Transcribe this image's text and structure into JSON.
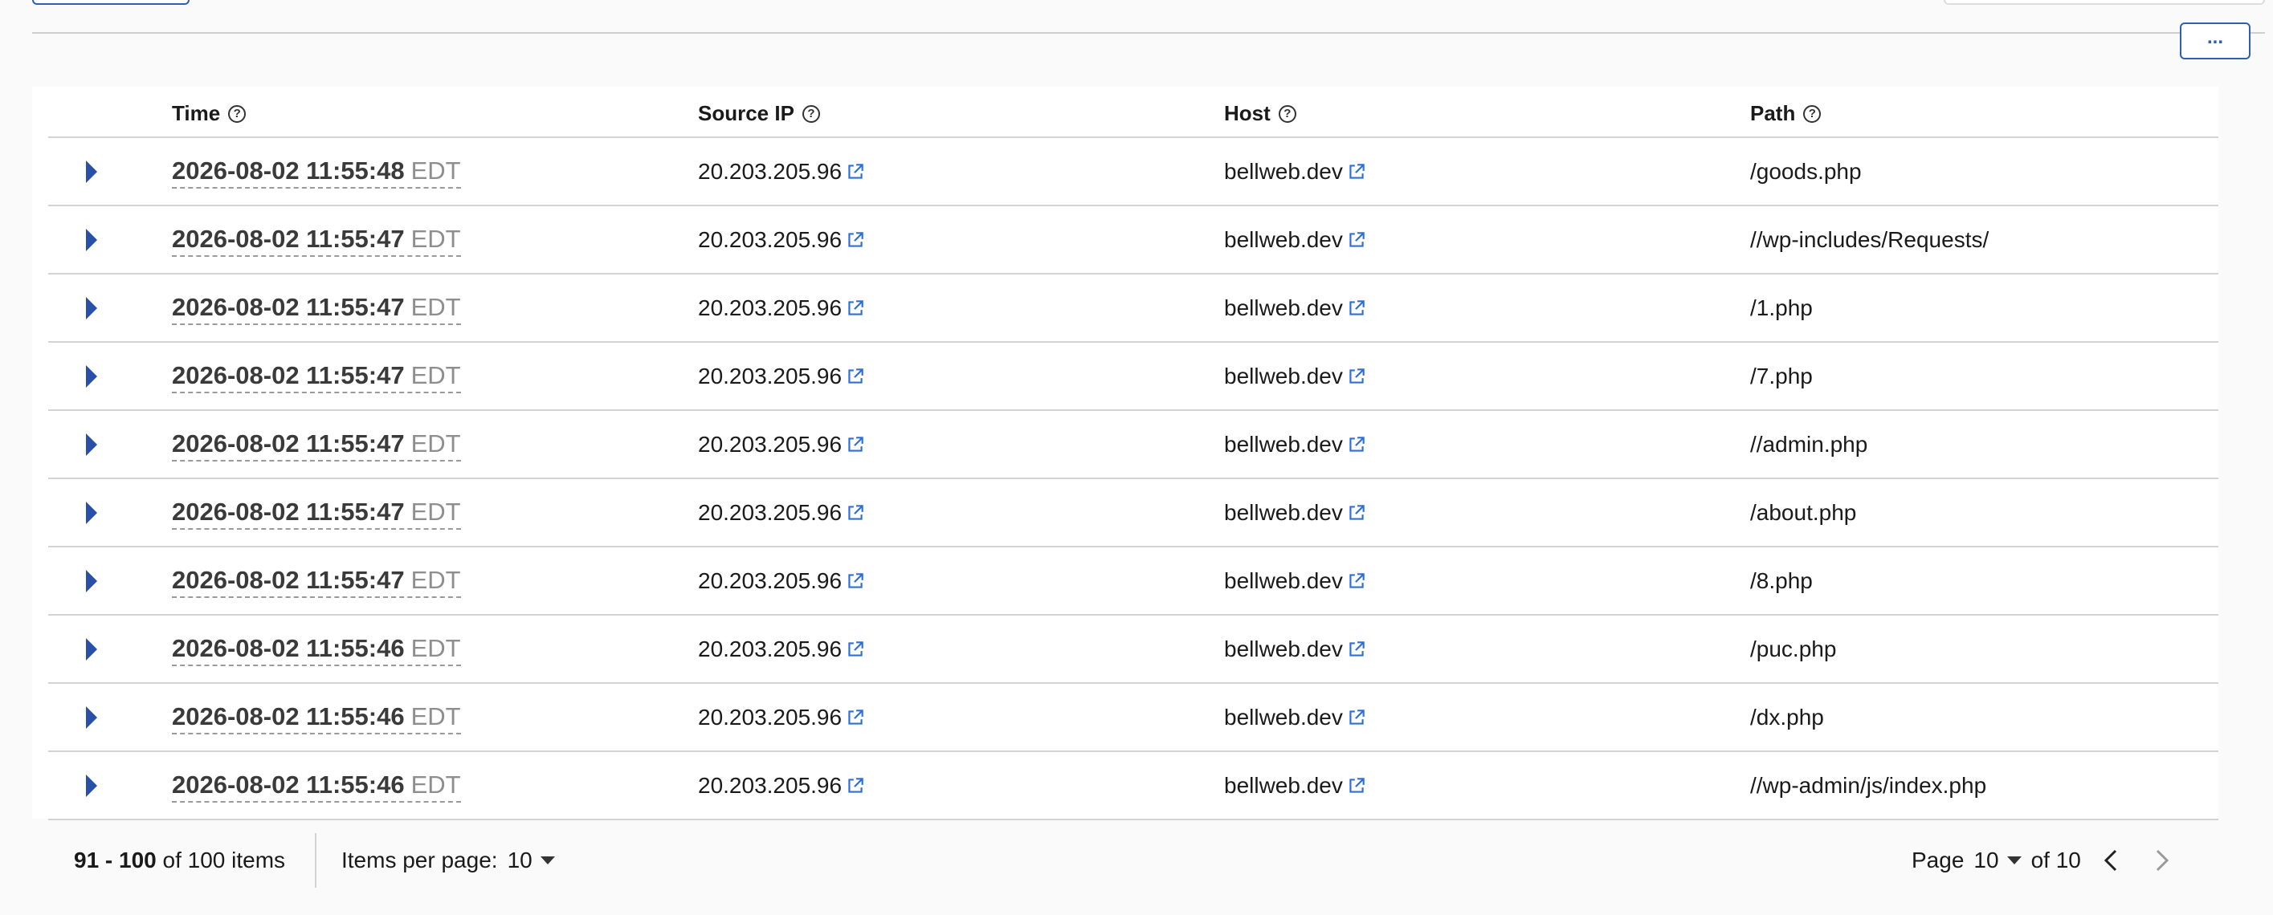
{
  "table": {
    "columns": [
      "Time",
      "Source IP",
      "Host",
      "Path"
    ],
    "rows": [
      {
        "date": "2026-08-02 11:55:48",
        "tz": "EDT",
        "ip": "20.203.205.96",
        "host": "bellweb.dev",
        "path": "/goods.php"
      },
      {
        "date": "2026-08-02 11:55:47",
        "tz": "EDT",
        "ip": "20.203.205.96",
        "host": "bellweb.dev",
        "path": "//wp-includes/Requests/"
      },
      {
        "date": "2026-08-02 11:55:47",
        "tz": "EDT",
        "ip": "20.203.205.96",
        "host": "bellweb.dev",
        "path": "/1.php"
      },
      {
        "date": "2026-08-02 11:55:47",
        "tz": "EDT",
        "ip": "20.203.205.96",
        "host": "bellweb.dev",
        "path": "/7.php"
      },
      {
        "date": "2026-08-02 11:55:47",
        "tz": "EDT",
        "ip": "20.203.205.96",
        "host": "bellweb.dev",
        "path": "//admin.php"
      },
      {
        "date": "2026-08-02 11:55:47",
        "tz": "EDT",
        "ip": "20.203.205.96",
        "host": "bellweb.dev",
        "path": "/about.php"
      },
      {
        "date": "2026-08-02 11:55:47",
        "tz": "EDT",
        "ip": "20.203.205.96",
        "host": "bellweb.dev",
        "path": "/8.php"
      },
      {
        "date": "2026-08-02 11:55:46",
        "tz": "EDT",
        "ip": "20.203.205.96",
        "host": "bellweb.dev",
        "path": "/puc.php"
      },
      {
        "date": "2026-08-02 11:55:46",
        "tz": "EDT",
        "ip": "20.203.205.96",
        "host": "bellweb.dev",
        "path": "/dx.php"
      },
      {
        "date": "2026-08-02 11:55:46",
        "tz": "EDT",
        "ip": "20.203.205.96",
        "host": "bellweb.dev",
        "path": "//wp-admin/js/index.php"
      }
    ]
  },
  "toolbar": {
    "more_label": "..."
  },
  "footer": {
    "range": "91 - 100",
    "range_suffix": "of 100 items",
    "items_per_page_label": "Items per page:",
    "items_per_page_value": "10",
    "page_label": "Page",
    "page_value": "10",
    "page_of": "of 10"
  },
  "icons": {
    "help": "help-icon",
    "expand": "expand-row-icon",
    "external": "external-link-icon",
    "prev": "chevron-left-icon",
    "next": "chevron-right-icon"
  },
  "colors": {
    "accent": "#2a4fa8",
    "link_icon": "#2f6fd1"
  }
}
